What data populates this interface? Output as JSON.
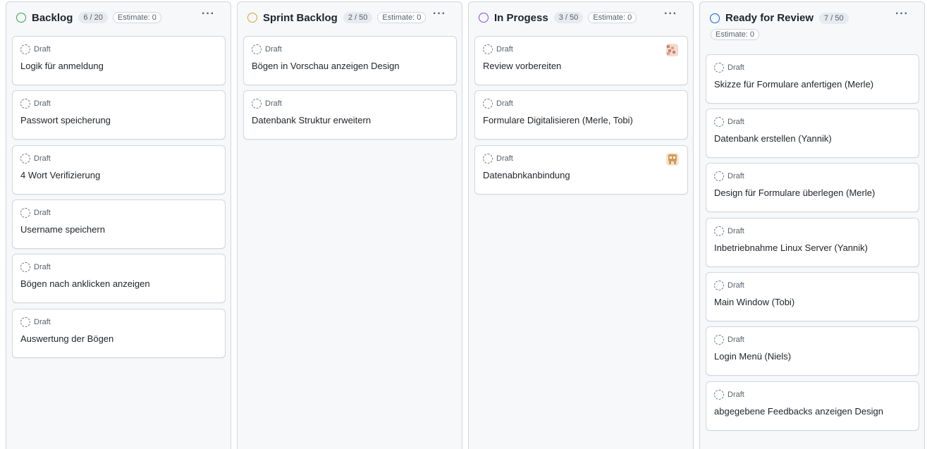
{
  "columns": [
    {
      "title": "Backlog",
      "count": "6 / 20",
      "estimate": "Estimate: 0",
      "status_color": "#2da44e",
      "cards": [
        {
          "status": "Draft",
          "title": "Logik für anmeldung"
        },
        {
          "status": "Draft",
          "title": "Passwort speicherung"
        },
        {
          "status": "Draft",
          "title": "4 Wort Verifizierung"
        },
        {
          "status": "Draft",
          "title": "Username speichern"
        },
        {
          "status": "Draft",
          "title": "Bögen nach anklicken anzeigen"
        },
        {
          "status": "Draft",
          "title": "Auswertung der Bögen"
        }
      ]
    },
    {
      "title": "Sprint Backlog",
      "count": "2 / 50",
      "estimate": "Estimate: 0",
      "status_color": "#d4a72c",
      "cards": [
        {
          "status": "Draft",
          "title": "Bögen in Vorschau anzeigen Design"
        },
        {
          "status": "Draft",
          "title": "Datenbank Struktur erweitern"
        }
      ]
    },
    {
      "title": "In Progess",
      "count": "3 / 50",
      "estimate": "Estimate: 0",
      "status_color": "#8250df",
      "cards": [
        {
          "status": "Draft",
          "title": "Review vorbereiten",
          "avatar": "pixel-avatar-icon"
        },
        {
          "status": "Draft",
          "title": "Formulare Digitalisieren (Merle, Tobi)"
        },
        {
          "status": "Draft",
          "title": "Datenabnkanbindung",
          "avatar": "pixel-avatar-icon"
        }
      ]
    },
    {
      "title": "Ready for Review",
      "count": "7 / 50",
      "estimate": "Estimate: 0",
      "status_color": "#0969da",
      "cards": [
        {
          "status": "Draft",
          "title": "Skizze für Formulare anfertigen (Merle)"
        },
        {
          "status": "Draft",
          "title": "Datenbank erstellen (Yannik)"
        },
        {
          "status": "Draft",
          "title": "Design für Formulare überlegen (Merle)"
        },
        {
          "status": "Draft",
          "title": "Inbetriebnahme Linux Server (Yannik)"
        },
        {
          "status": "Draft",
          "title": "Main Window (Tobi)"
        },
        {
          "status": "Draft",
          "title": "Login Menü (Niels)"
        },
        {
          "status": "Draft",
          "title": "abgegebene Feedbacks anzeigen Design"
        }
      ]
    }
  ],
  "menu_icon": "ellipsis-icon",
  "draft_icon": "dashed-circle-icon"
}
